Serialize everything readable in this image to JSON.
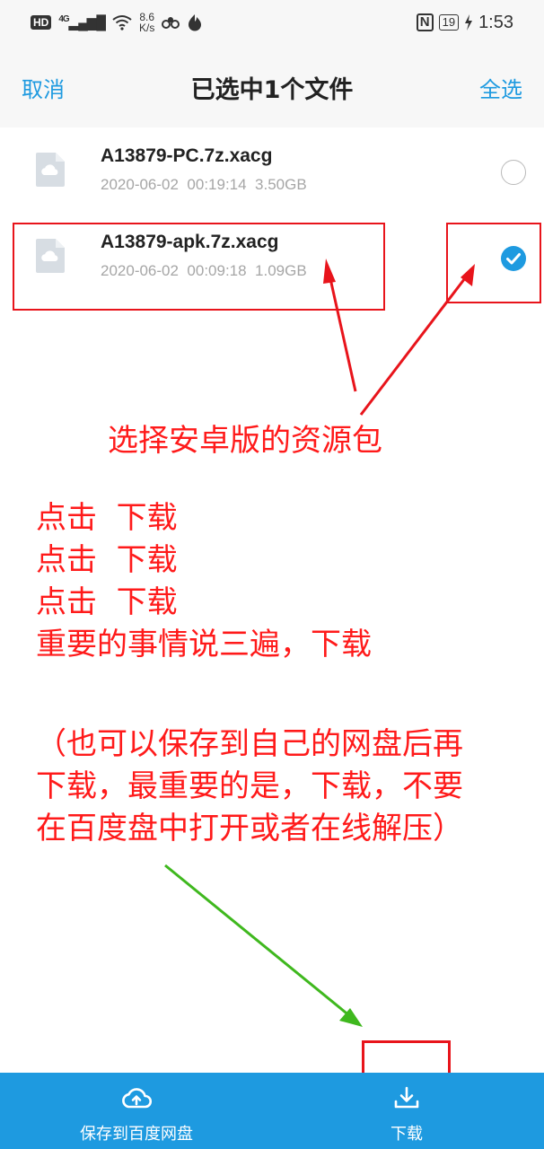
{
  "status_bar": {
    "hd": "HD",
    "signal": "4G",
    "speed_value": "8.6",
    "speed_unit": "K/s",
    "nfc": "N",
    "battery": "19",
    "time": "1:53"
  },
  "header": {
    "cancel_label": "取消",
    "title": "已选中1个文件",
    "select_all_label": "全选"
  },
  "files": [
    {
      "name": "A13879-PC.7z.xacg",
      "meta": "2020-06-02  00:19:14  3.50GB",
      "checked": false
    },
    {
      "name": "A13879-apk.7z.xacg",
      "meta": "2020-06-02  00:09:18  1.09GB",
      "checked": true
    }
  ],
  "annotations": {
    "choose_note": "选择安卓版的资源包",
    "click_lines": "点击  下载\n点击  下载\n点击  下载\n重要的事情说三遍，下载",
    "paren_note": "（也可以保存到自己的网盘后再\n下载，最重要的是，下载，不要\n在百度盘中打开或者在线解压）"
  },
  "bottom_bar": {
    "save_label": "保存到百度网盘",
    "download_label": "下载"
  },
  "colors": {
    "accent": "#1e9ae0",
    "annotation_red": "#ff1a1a",
    "annotation_green": "#3fb81e"
  }
}
